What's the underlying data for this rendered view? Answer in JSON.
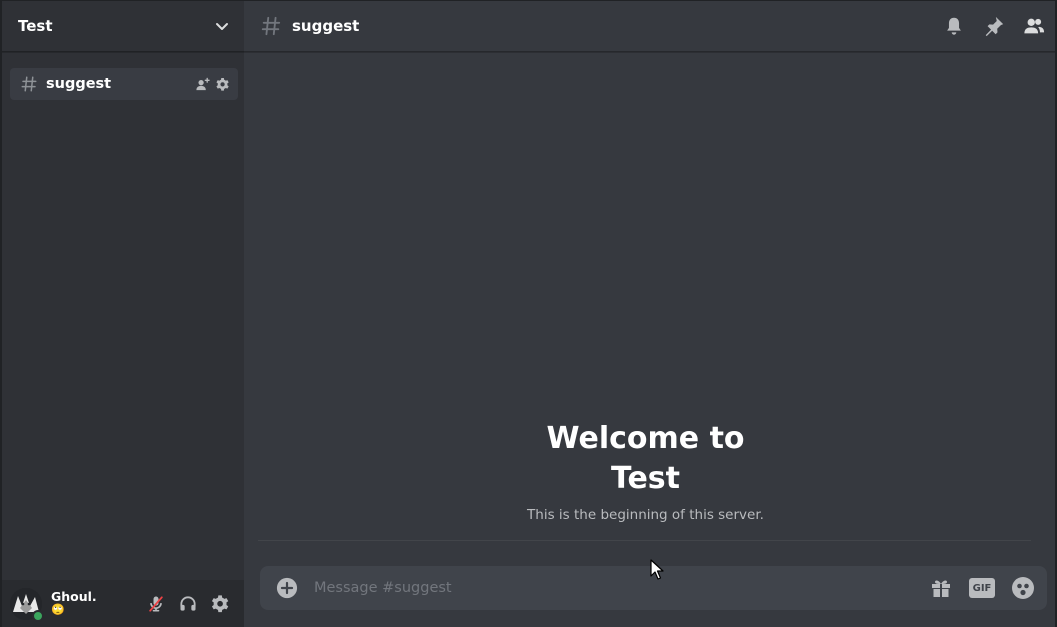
{
  "server": {
    "name": "Test"
  },
  "channels": [
    {
      "name": "suggest",
      "selected": true
    }
  ],
  "header": {
    "channel_name": "suggest"
  },
  "welcome": {
    "title": "Welcome to Test",
    "subtitle": "This is the beginning of this server."
  },
  "composer": {
    "placeholder": "Message #suggest",
    "gif_label": "GIF"
  },
  "user": {
    "name": "Ghoul.",
    "status_emoji": "🙄",
    "presence": "online"
  },
  "colors": {
    "sidebar_bg": "#2f3136",
    "main_bg": "#36393f",
    "input_bg": "#40444b",
    "user_panel_bg": "#292b2f",
    "online": "#3ba55d",
    "muted": "#ed4245"
  },
  "icons": {
    "server_menu": "chevron-down-icon",
    "channel": "hash-icon",
    "invite": "add-member-icon",
    "channel_settings": "gear-icon",
    "notifications": "bell-icon",
    "pins": "pin-icon",
    "members": "members-icon",
    "attach": "plus-circle-icon",
    "gift": "gift-icon",
    "emoji": "emoji-icon",
    "mic": "microphone-muted-icon",
    "headphones": "headphones-icon",
    "user_settings": "gear-icon"
  }
}
